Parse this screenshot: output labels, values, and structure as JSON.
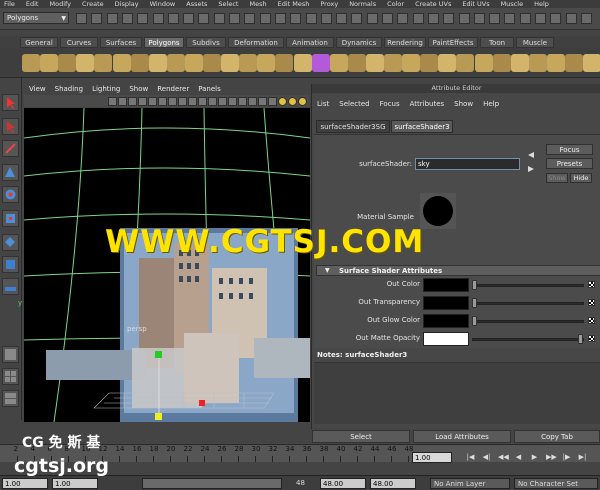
{
  "menubar": {
    "items": [
      "File",
      "Edit",
      "Modify",
      "Create",
      "Display",
      "Window",
      "Assets",
      "Select",
      "Mesh",
      "Edit Mesh",
      "Proxy",
      "Normals",
      "Color",
      "Create UVs",
      "Edit UVs",
      "Muscle",
      "Help"
    ]
  },
  "statusline": {
    "mode": "Polygons"
  },
  "shelf": {
    "tabs": [
      "General",
      "Curves",
      "Surfaces",
      "Polygons",
      "Subdivs",
      "Deformation",
      "Animation",
      "Dynamics",
      "Rendering",
      "PaintEffects",
      "Toon",
      "Muscle"
    ],
    "active_tab": "Polygons"
  },
  "viewport": {
    "menus": [
      "View",
      "Shading",
      "Lighting",
      "Show",
      "Renderer",
      "Panels"
    ],
    "camera": "persp",
    "axis": "y"
  },
  "attribute_editor": {
    "title": "Attribute Editor",
    "menus": [
      "List",
      "Selected",
      "Focus",
      "Attributes",
      "Show",
      "Help"
    ],
    "tabs": [
      "surfaceShader3SG",
      "surfaceShader3"
    ],
    "active_tab": "surfaceShader3",
    "shader_label": "surfaceShader:",
    "shader_value": "sky",
    "focus_button": "Focus",
    "presets_button": "Presets",
    "show_button": "Show",
    "hide_button": "Hide",
    "material_sample_label": "Material Sample",
    "section_title": "Surface Shader Attributes",
    "attributes": [
      {
        "label": "Out Color",
        "swatch": "#000000",
        "slider_value": 0
      },
      {
        "label": "Out Transparency",
        "swatch": "#000000",
        "slider_value": 0
      },
      {
        "label": "Out Glow Color",
        "swatch": "#000000",
        "slider_value": 0
      },
      {
        "label": "Out Matte Opacity",
        "swatch": "#ffffff",
        "slider_value": 1
      }
    ],
    "notes_label": "Notes:  surfaceShader3",
    "footer_buttons": [
      "Select",
      "Load Attributes",
      "Copy Tab"
    ]
  },
  "timeline": {
    "ticks": [
      "2",
      "4",
      "6",
      "8",
      "10",
      "12",
      "14",
      "16",
      "18",
      "20",
      "22",
      "24",
      "26",
      "28",
      "30",
      "32",
      "34",
      "36",
      "38",
      "40",
      "42",
      "44",
      "46",
      "48"
    ],
    "current_frame": "1.00"
  },
  "range": {
    "start": "1.00",
    "playback_start": "1.00",
    "slider_value": "48",
    "playback_end": "48.00",
    "end": "48.00",
    "anim_layer": "No Anim Layer",
    "character_set": "No Character Set"
  },
  "watermark": {
    "top": "WWW.CGTSJ.COM",
    "cn": "CG 免 斯 基",
    "url": "cgtsj.org"
  },
  "colors": {
    "accent": "#ffe400",
    "grid": "#7fd48c"
  }
}
